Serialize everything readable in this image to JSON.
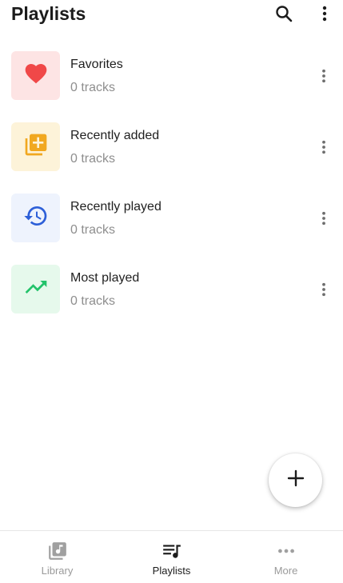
{
  "header": {
    "title": "Playlists",
    "search_icon": "search-icon",
    "menu_icon": "more-vert-icon"
  },
  "playlists": [
    {
      "name": "Favorites",
      "subtitle": "0 tracks",
      "icon": "heart-icon",
      "icon_color": "#f04848",
      "tile_color": "#fde4e4"
    },
    {
      "name": "Recently added",
      "subtitle": "0 tracks",
      "icon": "add-to-queue-icon",
      "icon_color": "#f1a820",
      "tile_color": "#fdf3d9"
    },
    {
      "name": "Recently played",
      "subtitle": "0 tracks",
      "icon": "history-icon",
      "icon_color": "#2d5fd8",
      "tile_color": "#eef3fd"
    },
    {
      "name": "Most played",
      "subtitle": "0 tracks",
      "icon": "trending-up-icon",
      "icon_color": "#22c36a",
      "tile_color": "#e6f9ec"
    }
  ],
  "fab": {
    "icon": "plus-icon"
  },
  "bottom_nav": [
    {
      "label": "Library",
      "icon": "library-music-icon",
      "active": false
    },
    {
      "label": "Playlists",
      "icon": "playlist-music-icon",
      "active": true
    },
    {
      "label": "More",
      "icon": "more-horiz-icon",
      "active": false
    }
  ]
}
